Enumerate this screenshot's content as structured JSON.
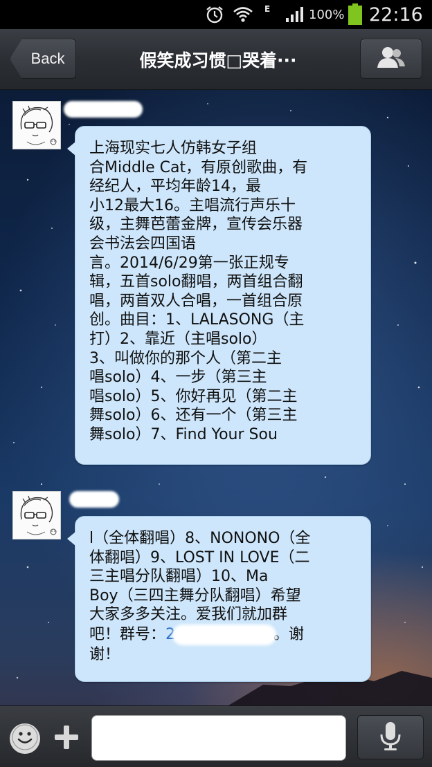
{
  "status_bar": {
    "network": "E",
    "battery": "100%",
    "time": "22:16",
    "icons": [
      "alarm-icon",
      "wifi-icon",
      "signal-icon",
      "battery-icon"
    ]
  },
  "header": {
    "back_label": "Back",
    "title": "假笑成习惯□哭着···"
  },
  "messages": [
    {
      "lines": [
        "上海现实七人仿韩女子组",
        "合Middle Cat，有原创歌曲，有",
        "经纪人，平均年龄14，最",
        "小12最大16。主唱流行声乐十",
        "级，主舞芭蕾金牌，宣传会乐器",
        "会书法会四国语",
        "言。2014/6/29第一张正规专",
        "辑，五首solo翻唱，两首组合翻",
        "唱，两首双人合唱，一首组合原",
        "创。曲目：1、LALASONG（主",
        "打）2、靠近（主唱solo）",
        "3、叫做你的那个人（第二主",
        "唱solo）4、一步（第三主",
        "唱solo）5、你好再见（第二主",
        "舞solo）6、还有一个（第三主",
        "舞solo）7、Find Your Sou"
      ]
    },
    {
      "lines": [
        "l（全体翻唱）8、NONONO（全",
        "体翻唱）9、LOST IN LOVE（二",
        "三主唱分队翻唱）10、Ma",
        "Boy（三四主舞分队翻唱）希望",
        "大家多多关注。爱我们就加群"
      ],
      "group_prefix": "吧！群号：",
      "group_number_visible": "2",
      "group_suffix": "。谢",
      "last_line": "谢！"
    }
  ],
  "colors": {
    "bubble": "#cde6fb",
    "header": "#2b2e33",
    "link": "#2a6fc4"
  },
  "input": {
    "placeholder": ""
  }
}
